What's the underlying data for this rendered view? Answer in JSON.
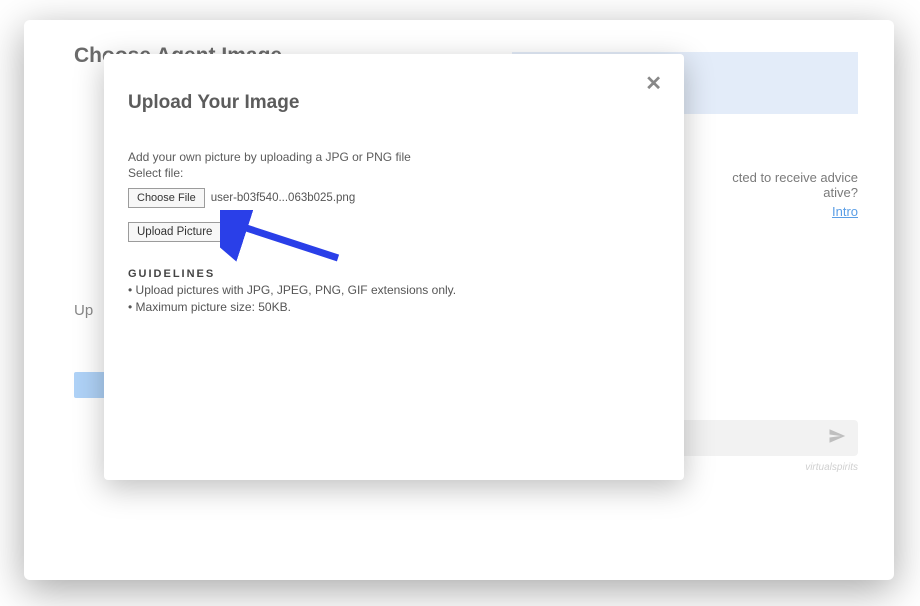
{
  "background": {
    "title": "Choose Agent Image",
    "upload_label": "Up",
    "right_text_1": "cted to receive advice",
    "right_text_2": "ative?",
    "intro_link": "Intro",
    "brand": "virtualspirits"
  },
  "modal": {
    "title": "Upload Your Image",
    "description": "Add your own picture by uploading a JPG or PNG file",
    "select_label": "Select file:",
    "choose_file_btn": "Choose File",
    "file_name": "user-b03f540...063b025.png",
    "upload_btn": "Upload Picture",
    "guidelines_title": "GUIDELINES",
    "guideline_1": "• Upload pictures with JPG, JPEG, PNG, GIF extensions only.",
    "guideline_2": "• Maximum picture size: 50KB."
  },
  "annotation": {
    "arrow_color": "#2a3fe8"
  }
}
